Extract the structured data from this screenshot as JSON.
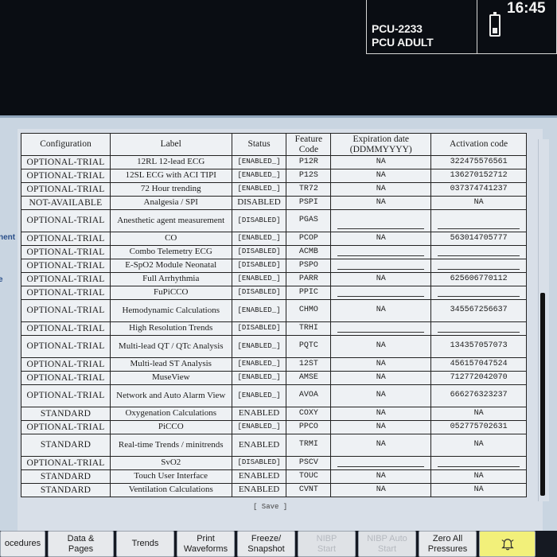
{
  "device": {
    "id": "PCU-2233",
    "profile": "PCU ADULT",
    "time": "16:45"
  },
  "side_labels": [
    "nent",
    "e"
  ],
  "table": {
    "headers": [
      "Configuration",
      "Label",
      "Status",
      "Feature\nCode",
      "Expiration date\n(DDMMYYYY)",
      "Activation code"
    ],
    "rows": [
      {
        "cfg": "OPTIONAL-TRIAL",
        "label": "12RL 12-lead ECG",
        "status": "[ENABLED_]",
        "code": "P12R",
        "exp": "NA",
        "act": "322475576561"
      },
      {
        "cfg": "OPTIONAL-TRIAL",
        "label": "12SL ECG with ACI TIPI",
        "status": "[ENABLED_]",
        "code": "P12S",
        "exp": "NA",
        "act": "136270152712"
      },
      {
        "cfg": "OPTIONAL-TRIAL",
        "label": "72 Hour trending",
        "status": "[ENABLED_]",
        "code": "TR72",
        "exp": "NA",
        "act": "037374741237"
      },
      {
        "cfg": "NOT-AVAILABLE",
        "label": "Analgesia / SPI",
        "status": "DISABLED",
        "code": "PSPI",
        "exp": "NA",
        "act": "NA"
      },
      {
        "cfg": "OPTIONAL-TRIAL",
        "label": "Anesthetic agent measurement",
        "status": "[DISABLED]",
        "code": "PGAS",
        "exp": "",
        "act": ""
      },
      {
        "cfg": "OPTIONAL-TRIAL",
        "label": "CO",
        "status": "[ENABLED_]",
        "code": "PCOP",
        "exp": "NA",
        "act": "563014705777"
      },
      {
        "cfg": "OPTIONAL-TRIAL",
        "label": "Combo Telemetry ECG",
        "status": "[DISABLED]",
        "code": "ACMB",
        "exp": "",
        "act": ""
      },
      {
        "cfg": "OPTIONAL-TRIAL",
        "label": "E-SpO2 Module Neonatal",
        "status": "[DISABLED]",
        "code": "PSPO",
        "exp": "",
        "act": ""
      },
      {
        "cfg": "OPTIONAL-TRIAL",
        "label": "Full Arrhythmia",
        "status": "[ENABLED_]",
        "code": "PARR",
        "exp": "NA",
        "act": "625606770112"
      },
      {
        "cfg": "OPTIONAL-TRIAL",
        "label": "FuPiCCO",
        "status": "[DISABLED]",
        "code": "PPIC",
        "exp": "",
        "act": ""
      },
      {
        "cfg": "OPTIONAL-TRIAL",
        "label": "Hemodynamic Calculations",
        "status": "[ENABLED_]",
        "code": "CHMO",
        "exp": "NA",
        "act": "345567256637"
      },
      {
        "cfg": "OPTIONAL-TRIAL",
        "label": "High Resolution Trends",
        "status": "[DISABLED]",
        "code": "TRHI",
        "exp": "",
        "act": ""
      },
      {
        "cfg": "OPTIONAL-TRIAL",
        "label": "Multi-lead QT / QTc Analysis",
        "status": "[ENABLED_]",
        "code": "PQTC",
        "exp": "NA",
        "act": "134357057073"
      },
      {
        "cfg": "OPTIONAL-TRIAL",
        "label": "Multi-lead ST Analysis",
        "status": "[ENABLED_]",
        "code": "12ST",
        "exp": "NA",
        "act": "456157047524"
      },
      {
        "cfg": "OPTIONAL-TRIAL",
        "label": "MuseView",
        "status": "[ENABLED_]",
        "code": "AMSE",
        "exp": "NA",
        "act": "712772042070"
      },
      {
        "cfg": "OPTIONAL-TRIAL",
        "label": "Network and Auto Alarm View",
        "status": "[ENABLED_]",
        "code": "AVOA",
        "exp": "NA",
        "act": "666276323237"
      },
      {
        "cfg": "STANDARD",
        "label": "Oxygenation Calculations",
        "status": "ENABLED",
        "code": "COXY",
        "exp": "NA",
        "act": "NA"
      },
      {
        "cfg": "OPTIONAL-TRIAL",
        "label": "PiCCO",
        "status": "[ENABLED_]",
        "code": "PPCO",
        "exp": "NA",
        "act": "052775702631"
      },
      {
        "cfg": "STANDARD",
        "label": "Real-time Trends / minitrends",
        "status": "ENABLED",
        "code": "TRMI",
        "exp": "NA",
        "act": "NA"
      },
      {
        "cfg": "OPTIONAL-TRIAL",
        "label": "SvO2",
        "status": "[DISABLED]",
        "code": "PSCV",
        "exp": "",
        "act": ""
      },
      {
        "cfg": "STANDARD",
        "label": "Touch User Interface",
        "status": "ENABLED",
        "code": "TOUC",
        "exp": "NA",
        "act": "NA"
      },
      {
        "cfg": "STANDARD",
        "label": "Ventilation Calculations",
        "status": "ENABLED",
        "code": "CVNT",
        "exp": "NA",
        "act": "NA"
      }
    ]
  },
  "save_label": "[ Save ]",
  "buttons": [
    {
      "name": "procedures-button",
      "label": "ocedures",
      "width": 57,
      "dim": false
    },
    {
      "name": "data-pages-button",
      "label": "Data &\nPages",
      "width": 83,
      "dim": false
    },
    {
      "name": "trends-button",
      "label": "Trends",
      "width": 73,
      "dim": false
    },
    {
      "name": "print-waveforms-button",
      "label": "Print\nWaveforms",
      "width": 73,
      "dim": false
    },
    {
      "name": "freeze-snapshot-button",
      "label": "Freeze/\nSnapshot",
      "width": 73,
      "dim": false
    },
    {
      "name": "nibp-start-button",
      "label": "NIBP\nStart",
      "width": 73,
      "dim": true
    },
    {
      "name": "nibp-auto-start-button",
      "label": "NIBP Auto\nStart",
      "width": 73,
      "dim": true
    },
    {
      "name": "zero-all-pressures-button",
      "label": "Zero All\nPressures",
      "width": 73,
      "dim": false
    }
  ],
  "colors": {
    "alarm_button": "#f2f07a",
    "panel": "#c9d5e1",
    "table_bg": "#eef1f4"
  }
}
